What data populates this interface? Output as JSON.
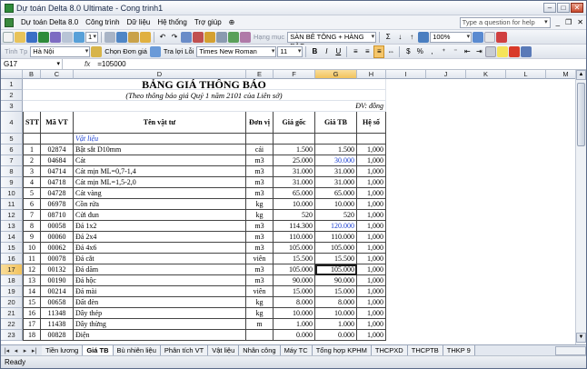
{
  "window": {
    "title": "Dự toán Delta 8.0 Ultimate - Cong trinh1",
    "min": "–",
    "max": "□",
    "close": "✕"
  },
  "menu": {
    "items": [
      "Dự toán Delta 8.0",
      "Công trình",
      "Dữ liệu",
      "Hệ thống",
      "Trợ giúp"
    ],
    "help_placeholder": "Type a question for help",
    "wb_min": "_",
    "wb_restore": "❐",
    "wb_close": "✕"
  },
  "toolbar1": {
    "sheet_no": "1",
    "hang_muc_label": "Hạng mục",
    "hang_muc_value": "SÀN BÊ TÔNG + HÀNG RÀO",
    "zoom": "100%"
  },
  "toolbar2": {
    "tinh_label": "Tỉnh Tp",
    "province": "Hà Nội",
    "chon_don_gia": "Chọn Đơn giá",
    "tra_loi_label": "Tra lợi Lỗi",
    "font": "Times New Roman",
    "font_size": "11",
    "bold": "B",
    "italic": "I",
    "underline": "U",
    "currency": "$",
    "percent": "%",
    "comma": ","
  },
  "formula": {
    "namebox": "G17",
    "fx": "fx",
    "value": "=105000"
  },
  "columns": [
    "B",
    "C",
    "D",
    "E",
    "F",
    "G",
    "H",
    "I",
    "J",
    "K",
    "L",
    "M",
    "N"
  ],
  "sheet": {
    "title": "BẢNG GIÁ THÔNG BÁO",
    "subtitle": "(Theo thông báo giá Quý 1 năm 2101 của Liên sở)",
    "unit": "ĐV: đồng",
    "headers": [
      "STT",
      "Mã VT",
      "Tên vật tư",
      "Đơn vị",
      "Giá gốc",
      "Giá TB",
      "Hệ số"
    ],
    "group_label": "Vật liệu",
    "rows": [
      {
        "r": "6",
        "stt": "1",
        "ma": "02874",
        "ten": "Bật sắt D10mm",
        "dv": "cái",
        "goc": "1.500",
        "tb": "1.500",
        "hs": "1,000"
      },
      {
        "r": "7",
        "stt": "2",
        "ma": "04684",
        "ten": "Cát",
        "dv": "m3",
        "goc": "25.000",
        "tb": "30.000",
        "hs": "1,000",
        "blue": true
      },
      {
        "r": "8",
        "stt": "3",
        "ma": "04714",
        "ten": "Cát mịn ML=0,7-1,4",
        "dv": "m3",
        "goc": "31.000",
        "tb": "31.000",
        "hs": "1,000"
      },
      {
        "r": "9",
        "stt": "4",
        "ma": "04718",
        "ten": "Cát mịn ML=1,5-2,0",
        "dv": "m3",
        "goc": "31.000",
        "tb": "31.000",
        "hs": "1,000"
      },
      {
        "r": "10",
        "stt": "5",
        "ma": "04728",
        "ten": "Cát vàng",
        "dv": "m3",
        "goc": "65.000",
        "tb": "65.000",
        "hs": "1,000"
      },
      {
        "r": "11",
        "stt": "6",
        "ma": "06978",
        "ten": "Cồn rửa",
        "dv": "kg",
        "goc": "10.000",
        "tb": "10.000",
        "hs": "1,000"
      },
      {
        "r": "12",
        "stt": "7",
        "ma": "08710",
        "ten": "Cửi đun",
        "dv": "kg",
        "goc": "520",
        "tb": "520",
        "hs": "1,000"
      },
      {
        "r": "13",
        "stt": "8",
        "ma": "00058",
        "ten": "Đá 1x2",
        "dv": "m3",
        "goc": "114.300",
        "tb": "120.000",
        "hs": "1,000",
        "blue": true
      },
      {
        "r": "14",
        "stt": "9",
        "ma": "00060",
        "ten": "Đá 2x4",
        "dv": "m3",
        "goc": "110.000",
        "tb": "110.000",
        "hs": "1,000"
      },
      {
        "r": "15",
        "stt": "10",
        "ma": "00062",
        "ten": "Đá 4x6",
        "dv": "m3",
        "goc": "105.000",
        "tb": "105.000",
        "hs": "1,000"
      },
      {
        "r": "16",
        "stt": "11",
        "ma": "00078",
        "ten": "Đá cắt",
        "dv": "viên",
        "goc": "15.500",
        "tb": "15.500",
        "hs": "1,000"
      },
      {
        "r": "17",
        "stt": "12",
        "ma": "00132",
        "ten": "Đá dăm",
        "dv": "m3",
        "goc": "105.000",
        "tb": "105.000",
        "hs": "1,000",
        "sel": true
      },
      {
        "r": "18",
        "stt": "13",
        "ma": "00190",
        "ten": "Đá hộc",
        "dv": "m3",
        "goc": "90.000",
        "tb": "90.000",
        "hs": "1,000"
      },
      {
        "r": "19",
        "stt": "14",
        "ma": "00214",
        "ten": "Đá mài",
        "dv": "viên",
        "goc": "15.000",
        "tb": "15.000",
        "hs": "1,000"
      },
      {
        "r": "20",
        "stt": "15",
        "ma": "00658",
        "ten": "Đất đèn",
        "dv": "kg",
        "goc": "8.000",
        "tb": "8.000",
        "hs": "1,000"
      },
      {
        "r": "21",
        "stt": "16",
        "ma": "11348",
        "ten": "Dây thép",
        "dv": "kg",
        "goc": "10.000",
        "tb": "10.000",
        "hs": "1,000"
      },
      {
        "r": "22",
        "stt": "17",
        "ma": "11438",
        "ten": "Dây thừng",
        "dv": "m",
        "goc": "1.000",
        "tb": "1.000",
        "hs": "1,000"
      },
      {
        "r": "23",
        "stt": "18",
        "ma": "00828",
        "ten": "Điện",
        "dv": "",
        "goc": "0.000",
        "tb": "0.000",
        "hs": "1,000"
      }
    ]
  },
  "tabs": [
    "Tiền lương",
    "Giá TB",
    "Bù nhiên liệu",
    "Phân tích VT",
    "Vật liệu",
    "Nhân công",
    "Máy TC",
    "Tổng hợp KPHM",
    "THCPXD",
    "THCPTB",
    "THKP 9"
  ],
  "tab_nav": [
    "|◂",
    "◂",
    "▸",
    "▸|"
  ],
  "status": "Ready",
  "colors": {
    "selected_header": "#f2c25c",
    "blue_text": "#1a3fd1",
    "group_text": "#1a3fd1"
  }
}
